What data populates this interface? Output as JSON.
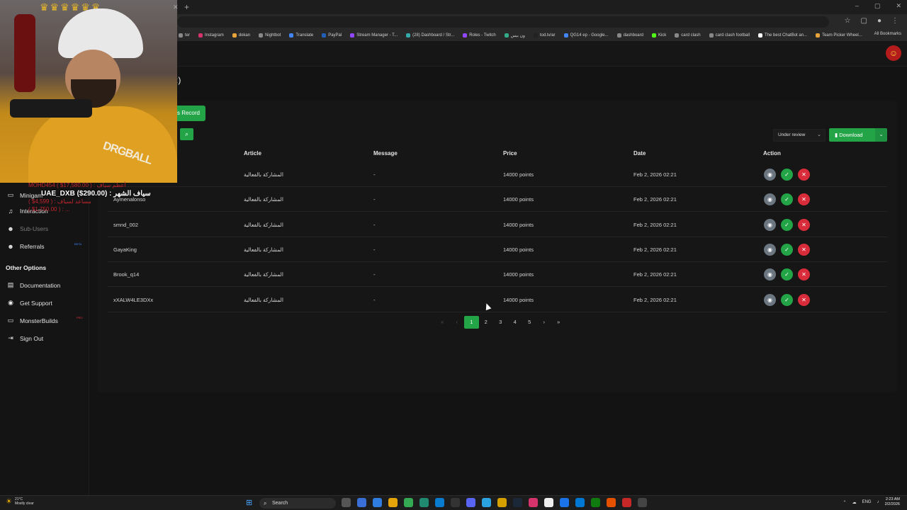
{
  "browser": {
    "new_tab": "+",
    "window_controls": [
      "–",
      "▢",
      "✕"
    ],
    "bookmarks": [
      "ter",
      "Instagram",
      "dokan",
      "Nightbot",
      "Translate",
      "PayPal",
      "Stream Manager - T...",
      "(28) Dashboard / Str...",
      "Roles - Twitch",
      "ون بيس",
      "tod.tv/ar",
      "QG14 ep - Google...",
      "dashboard",
      "Kick",
      "card clash",
      "card clash football",
      "The best ChatBot an...",
      "Team Picker Wheel..."
    ],
    "all_bookmarks": "All Bookmarks"
  },
  "sidebar": {
    "items": [
      {
        "label": "Minigam",
        "icon": "gamepad-icon"
      },
      {
        "label": "Interaction",
        "icon": "music-note-icon"
      },
      {
        "label": "Sub-Users",
        "icon": "users-icon",
        "dim": true
      },
      {
        "label": "Referrals",
        "icon": "users-icon",
        "badge": "BETA"
      }
    ],
    "other_title": "Other Options",
    "other_items": [
      {
        "label": "Documentation",
        "icon": "book-icon"
      },
      {
        "label": "Get Support",
        "icon": "support-icon"
      },
      {
        "label": "MonsterBuilds",
        "icon": "monitor-icon",
        "badge": "PRO"
      },
      {
        "label": "Sign Out",
        "icon": "sign-out-icon"
      }
    ]
  },
  "page": {
    "title_fragment": ":)",
    "tab_label": "s Record"
  },
  "toolbar": {
    "status_value": "Under review",
    "download_label": "Download"
  },
  "table": {
    "headers": [
      "Article",
      "Message",
      "Price",
      "Date",
      "Action"
    ],
    "rows": [
      {
        "user": "",
        "article": "المشاركة بالفعالية",
        "message": "-",
        "price": "14000 points",
        "date": "Feb 2, 2026 02:21"
      },
      {
        "user": "Aymenalonso",
        "article": "المشاركة بالفعالية",
        "message": "-",
        "price": "14000 points",
        "date": "Feb 2, 2026 02:21"
      },
      {
        "user": "smnd_002",
        "article": "المشاركة بالفعالية",
        "message": "-",
        "price": "14000 points",
        "date": "Feb 2, 2026 02:21"
      },
      {
        "user": "GayaKing",
        "article": "المشاركة بالفعالية",
        "message": "-",
        "price": "14000 points",
        "date": "Feb 2, 2026 02:21"
      },
      {
        "user": "Brook_q14",
        "article": "المشاركة بالفعالية",
        "message": "-",
        "price": "14000 points",
        "date": "Feb 2, 2026 02:21"
      },
      {
        "user": "xXALW4LE3DXx",
        "article": "المشاركة بالفعالية",
        "message": "-",
        "price": "14000 points",
        "date": "Feb 2, 2026 02:21"
      }
    ]
  },
  "pagination": {
    "pages": [
      "1",
      "2",
      "3",
      "4",
      "5"
    ],
    "current": "1"
  },
  "overlay": {
    "hoodie_text": "DRGBALL",
    "donor_lines": [
      "MOHD454 ( $17,580.00 ) : أعظم سياف",
      "( $4,599 ) : مساعد لسياف",
      "( $1,750.00 ) : ..."
    ],
    "donor_main": "UAE_DXB ($290.00) : سياف الشهر"
  },
  "taskbar": {
    "weather_temp": "21°C",
    "weather_desc": "Mostly clear",
    "search_label": "Search",
    "lang": "ENG",
    "time": "2:23 AM",
    "date": "2/2/2026"
  },
  "colors": {
    "accent": "#22a447",
    "danger": "#d92c3a",
    "view": "#6b7680"
  }
}
